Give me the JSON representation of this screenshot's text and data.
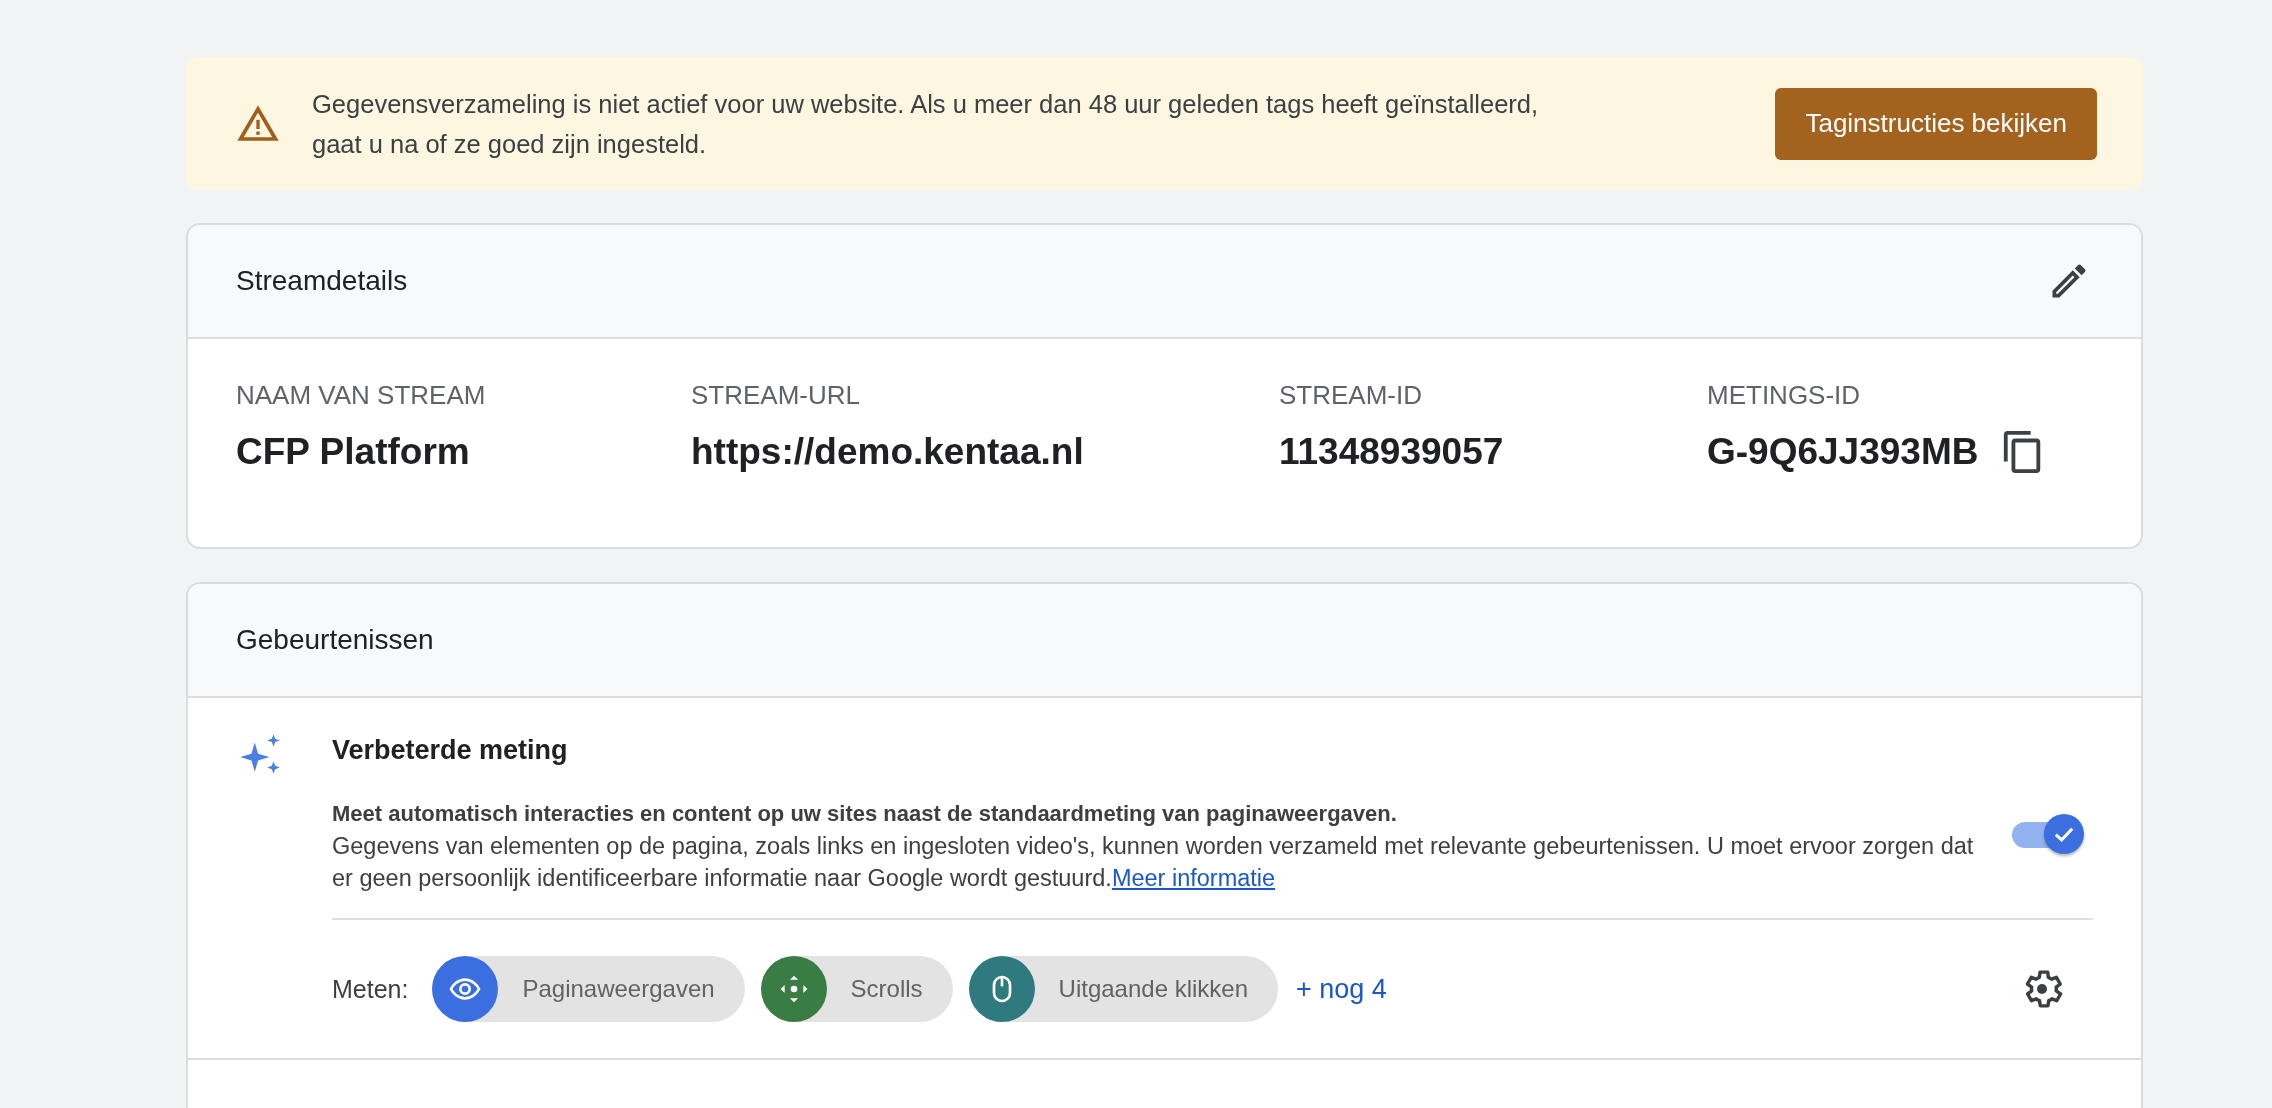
{
  "banner": {
    "message": "Gegevensverzameling is niet actief voor uw website. Als u meer dan 48 uur geleden tags heeft geïnstalleerd, gaat u na of ze goed zijn ingesteld.",
    "button": "Taginstructies bekijken"
  },
  "stream_details": {
    "title": "Streamdetails",
    "fields": [
      {
        "label": "NAAM VAN STREAM",
        "value": "CFP Platform",
        "copyable": false
      },
      {
        "label": "STREAM-URL",
        "value": "https://demo.kentaa.nl",
        "copyable": false
      },
      {
        "label": "STREAM-ID",
        "value": "11348939057",
        "copyable": false
      },
      {
        "label": "METINGS-ID",
        "value": "G-9Q6JJ393MB",
        "copyable": true
      }
    ]
  },
  "events": {
    "title": "Gebeurtenissen",
    "enhanced": {
      "title": "Verbeterde meting",
      "lead": "Meet automatisch interacties en content op uw sites naast de standaardmeting van paginaweergaven.",
      "body": "Gegevens van elementen op de pagina, zoals links en ingesloten video's, kunnen worden verzameld met relevante gebeurtenissen. U moet ervoor zorgen dat er geen persoonlijk identificeerbare informatie naar Google wordt gestuurd.",
      "link": "Meer informatie",
      "on": true,
      "measure_label": "Meten:",
      "chips": [
        {
          "kind": "eye",
          "label": "Paginaweergaven",
          "color": "#3b6fe0"
        },
        {
          "kind": "scroll",
          "label": "Scrolls",
          "color": "#3a7d44"
        },
        {
          "kind": "mouse",
          "label": "Uitgaande klikken",
          "color": "#2e7a7e"
        }
      ],
      "more": "+ nog 4"
    }
  }
}
